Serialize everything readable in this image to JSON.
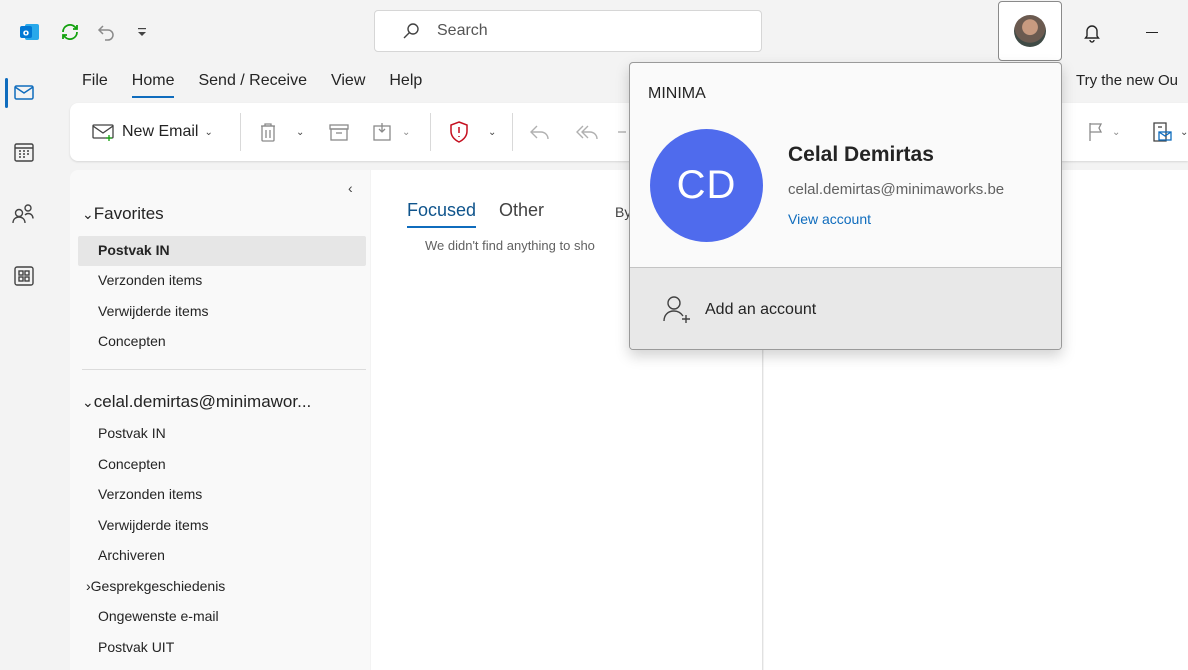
{
  "search": {
    "placeholder": "Search"
  },
  "menu": {
    "tabs": [
      "File",
      "Home",
      "Send / Receive",
      "View",
      "Help"
    ],
    "try_new": "Try the new Ou"
  },
  "ribbon": {
    "new_email": "New Email"
  },
  "folders": {
    "favorites_header": "Favorites",
    "favorites": [
      "Postvak IN",
      "Verzonden items",
      "Verwijderde items",
      "Concepten"
    ],
    "account_header": "celal.demirtas@minimawor...",
    "account_folders": [
      "Postvak IN",
      "Concepten",
      "Verzonden items",
      "Verwijderde items",
      "Archiveren",
      "Gesprekgeschiedenis",
      "Ongewenste e-mail",
      "Postvak UIT"
    ]
  },
  "messages": {
    "tab_focused": "Focused",
    "tab_other": "Other",
    "sort_by": "By",
    "empty": "We didn't find anything to sho"
  },
  "account_flyout": {
    "org": "MINIMA",
    "initials": "CD",
    "name": "Celal Demirtas",
    "email": "celal.demirtas@minimaworks.be",
    "view_account": "View account",
    "add_account": "Add an account"
  },
  "colors": {
    "accent": "#0f6cbd",
    "avatar": "#4f6bed",
    "outlook_blue": "#0078d4",
    "sync_green": "#13a10e"
  }
}
